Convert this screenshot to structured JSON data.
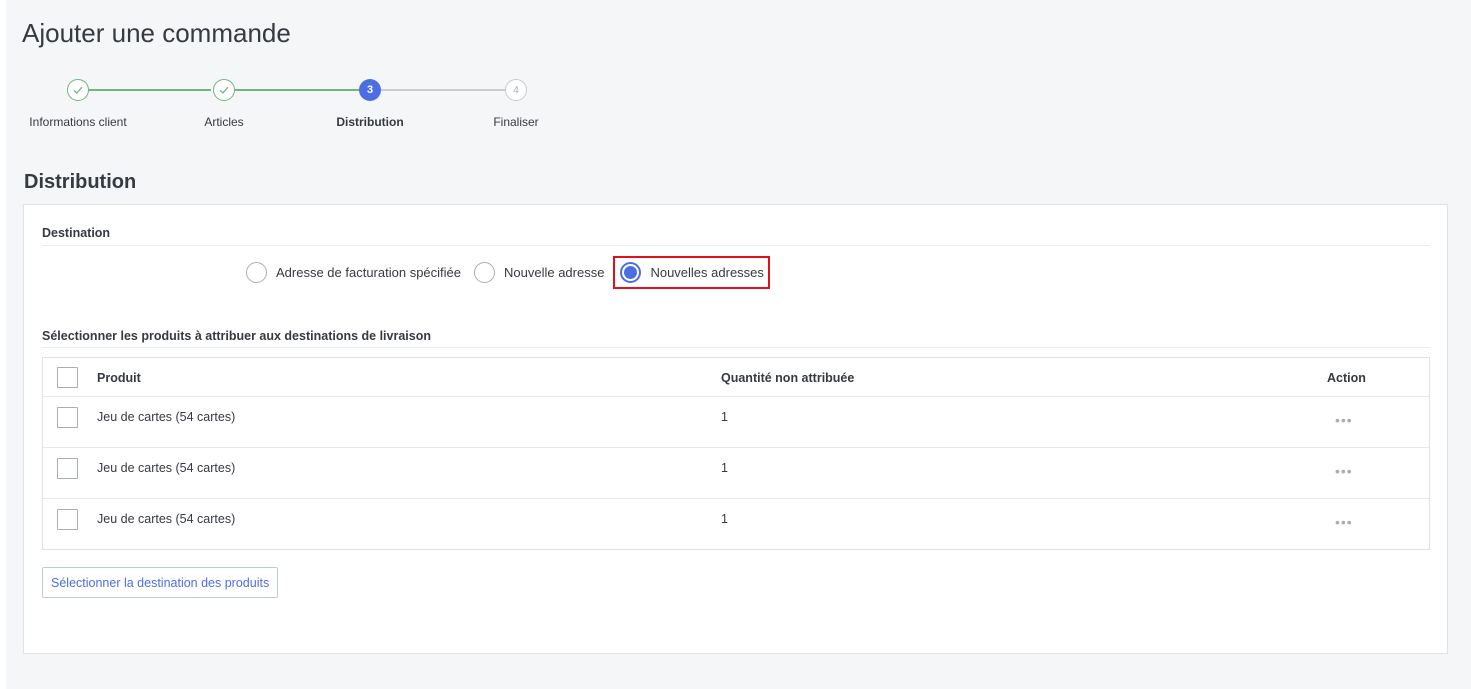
{
  "page": {
    "title": "Ajouter une commande"
  },
  "stepper": {
    "steps": [
      {
        "label": "Informations client",
        "status": "done",
        "number": "1"
      },
      {
        "label": "Articles",
        "status": "done",
        "number": "2"
      },
      {
        "label": "Distribution",
        "status": "active",
        "number": "3"
      },
      {
        "label": "Finaliser",
        "status": "todo",
        "number": "4"
      }
    ]
  },
  "section": {
    "title": "Distribution"
  },
  "destination": {
    "label": "Destination",
    "options": [
      {
        "label": "Adresse de facturation spécifiée",
        "checked": false
      },
      {
        "label": "Nouvelle adresse",
        "checked": false
      },
      {
        "label": "Nouvelles adresses",
        "checked": true
      }
    ]
  },
  "products": {
    "label": "Sélectionner les produits à attribuer aux destinations de livraison",
    "columns": {
      "product": "Produit",
      "quantity": "Quantité non attribuée",
      "action": "Action"
    },
    "rows": [
      {
        "product": "Jeu de cartes (54 cartes)",
        "quantity": "1"
      },
      {
        "product": "Jeu de cartes (54 cartes)",
        "quantity": "1"
      },
      {
        "product": "Jeu de cartes (54 cartes)",
        "quantity": "1"
      }
    ],
    "action_icon": "ellipsis-icon"
  },
  "actions": {
    "select_destination": "Sélectionner la destination des produits"
  },
  "colors": {
    "accent": "#4d6ee3",
    "success": "#70b580",
    "highlight": "#e0101f"
  }
}
